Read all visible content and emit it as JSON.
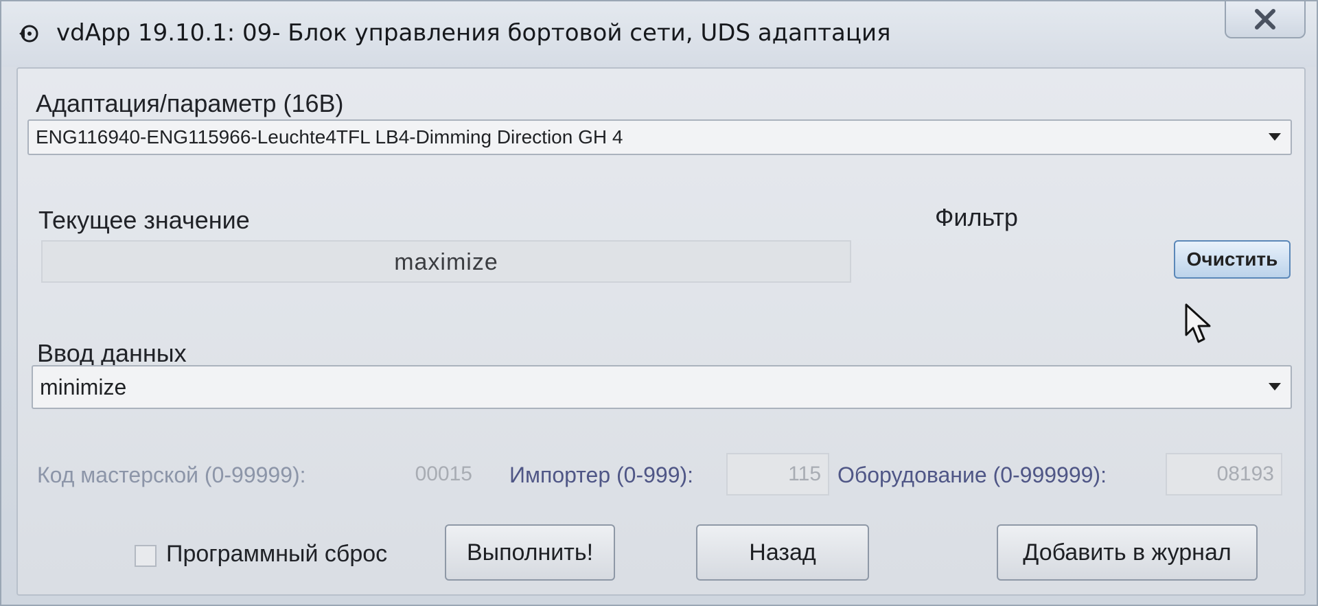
{
  "window": {
    "title": "vdApp 19.10.1: 09- Блок управления бортовой сети,  UDS адаптация",
    "close_symbol": "✕"
  },
  "adaptation": {
    "label": "Адаптация/параметр (16B)",
    "selected": "ENG116940-ENG115966-Leuchte4TFL LB4-Dimming Direction GH 4"
  },
  "current": {
    "label": "Текущее значение",
    "value": "maximize"
  },
  "filter": {
    "label": "Фильтр",
    "clear_button": "Очистить"
  },
  "input": {
    "label": "Ввод данных",
    "selected": "minimize"
  },
  "coding": {
    "workshop_label": "Код мастерской (0-99999):",
    "workshop_value": "00015",
    "importer_label": "Импортер (0-999):",
    "importer_value": "115",
    "equipment_label": "Оборудование (0-999999):",
    "equipment_value": "08193"
  },
  "actions": {
    "reset_label": "Программный сброс",
    "execute": "Выполнить!",
    "back": "Назад",
    "add_log": "Добавить в журнал"
  }
}
